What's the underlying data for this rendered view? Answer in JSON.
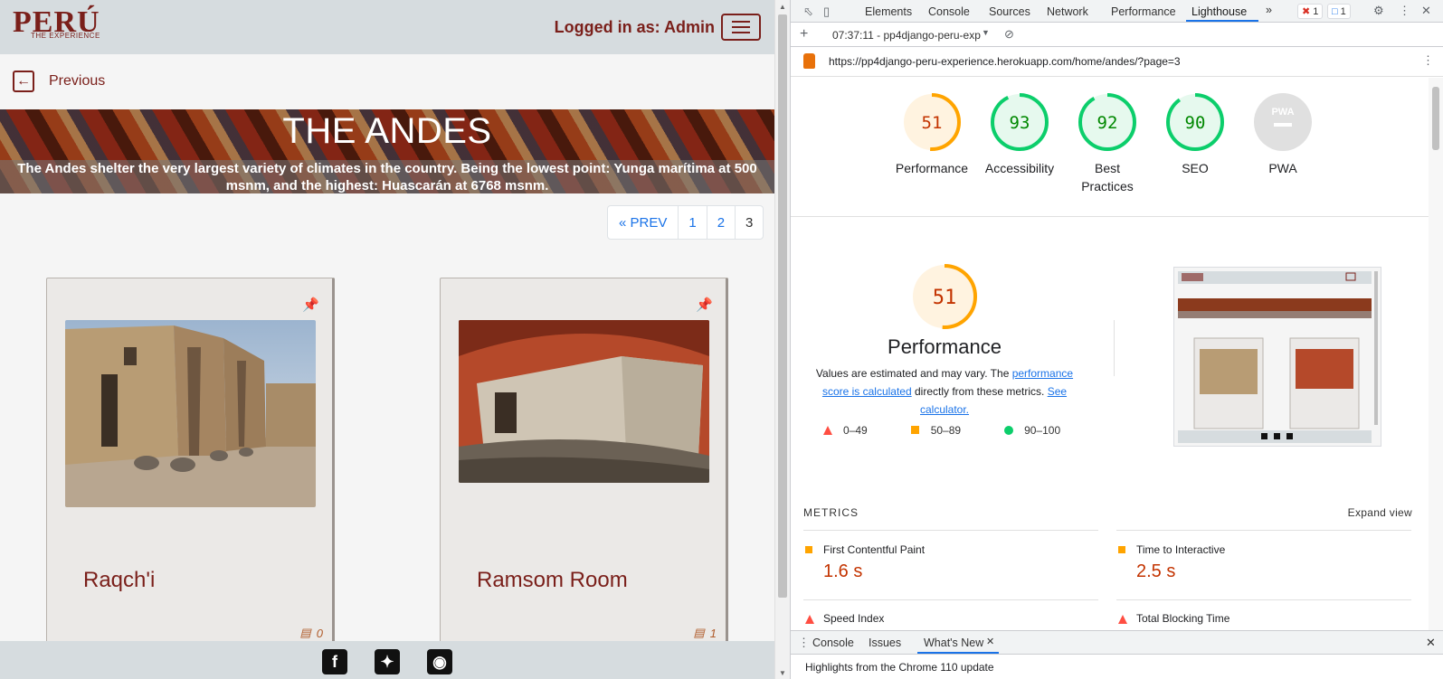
{
  "site": {
    "logo_text": "PERÚ",
    "logo_sub": "THE EXPERIENCE",
    "logged_in": "Logged in as: Admin",
    "previous_label": "Previous",
    "banner_title": "THE ANDES",
    "banner_desc": "The Andes shelter the very largest variety of climates in the country. Being the lowest point: Yunga marítima at 500 msnm, and the highest: Huascarán at 6768 msnm.",
    "pagination": [
      "« PREV",
      "1",
      "2",
      "3"
    ],
    "current_page": "3",
    "cards": [
      {
        "title": "Raqch'i",
        "comments": "0"
      },
      {
        "title": "Ramsom Room",
        "comments": "1"
      }
    ],
    "social": [
      "facebook-icon",
      "twitter-icon",
      "instagram-icon"
    ],
    "brand_color": "#7a1f1a"
  },
  "devtools": {
    "tabs": [
      "Elements",
      "Console",
      "Sources",
      "Network",
      "Performance",
      "Lighthouse"
    ],
    "active_tab": "Lighthouse",
    "more_tabs": "»",
    "error_count": "1",
    "message_count": "1",
    "report_time": "07:37:11 - pp4django-peru-exp",
    "url": "https://pp4django-peru-experience.herokuapp.com/home/andes/?page=3",
    "scores": [
      {
        "label": "Performance",
        "value": 51,
        "status": "average"
      },
      {
        "label": "Accessibility",
        "value": 93,
        "status": "pass"
      },
      {
        "label": "Best Practices",
        "value": 92,
        "status": "pass"
      },
      {
        "label": "SEO",
        "value": 90,
        "status": "pass"
      },
      {
        "label": "PWA",
        "value": null,
        "status": "na"
      }
    ],
    "pwa_badge": "PWA",
    "perf_score": "51",
    "perf_title": "Performance",
    "perf_desc_1": "Values are estimated and may vary. The ",
    "perf_desc_link1": "performance score is calculated",
    "perf_desc_2": " directly from these metrics. ",
    "perf_desc_link2": "See calculator.",
    "legend": [
      "0–49",
      "50–89",
      "90–100"
    ],
    "metrics_header": "METRICS",
    "expand_view": "Expand view",
    "metrics": [
      {
        "name": "First Contentful Paint",
        "value": "1.6 s",
        "status": "average"
      },
      {
        "name": "Time to Interactive",
        "value": "2.5 s",
        "status": "average"
      },
      {
        "name": "Speed Index",
        "value": "",
        "status": "fail"
      },
      {
        "name": "Total Blocking Time",
        "value": "",
        "status": "fail"
      }
    ],
    "drawer_tabs": [
      "Console",
      "Issues",
      "What's New"
    ],
    "drawer_message": "Highlights from the Chrome 110 update",
    "colors": {
      "pass": "#0cce6b",
      "average": "#ffa400",
      "fail": "#ff4e42",
      "accent": "#1a73e8"
    }
  }
}
